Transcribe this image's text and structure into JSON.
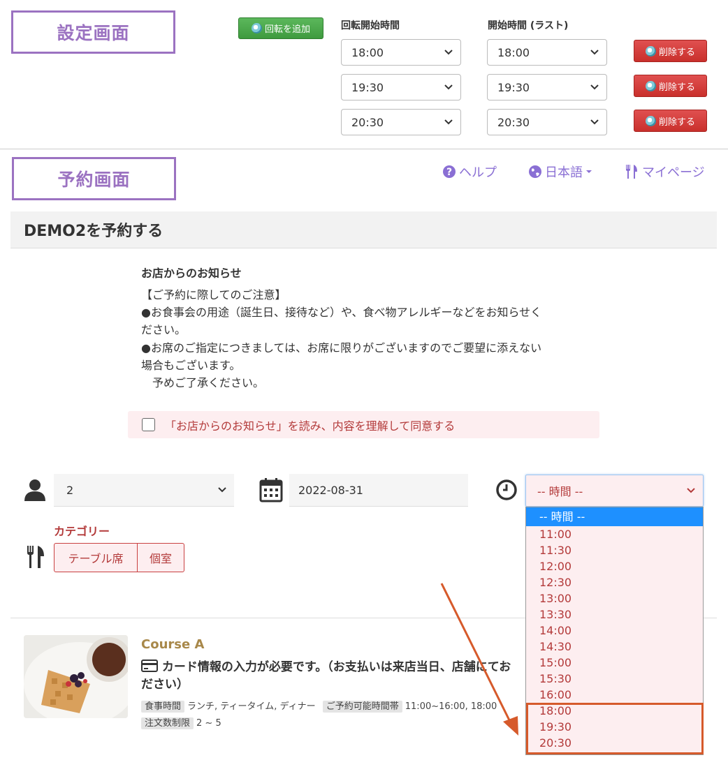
{
  "settings": {
    "label": "設定画面",
    "add_rotation_button": "回転を追加",
    "col_rotation_start": "回転開始時間",
    "col_start_last": "開始時間 (ラスト)",
    "rows": [
      {
        "rotation_start": "18:00",
        "start_last": "18:00",
        "delete_label": "削除する"
      },
      {
        "rotation_start": "19:30",
        "start_last": "19:30",
        "delete_label": "削除する"
      },
      {
        "rotation_start": "20:30",
        "start_last": "20:30",
        "delete_label": "削除する"
      }
    ]
  },
  "reservation": {
    "label": "予約画面",
    "nav": {
      "help": "ヘルプ",
      "language": "日本語",
      "mypage": "マイページ"
    },
    "title": "DEMO2を予約する",
    "notice": {
      "title": "お店からのお知らせ",
      "lines": [
        "【ご予約に際してのご注意】",
        "●お食事会の用途（誕生日、接待など）や、食べ物アレルギーなどをお知らせく",
        "ださい。",
        "●お席のご指定につきましては、お席に限りがございますのでご要望に添えない",
        "場合もございます。",
        "　予めご了承ください。"
      ],
      "agree_label": "「お店からのお知らせ」を読み、内容を理解して同意する"
    },
    "form": {
      "party_size": "2",
      "date": "2022-08-31",
      "time_placeholder": "-- 時間 --",
      "category_label": "カテゴリー",
      "categories": [
        "テーブル席",
        "個室"
      ]
    },
    "time_options": [
      "-- 時間 --",
      "11:00",
      "11:30",
      "12:00",
      "12:30",
      "13:00",
      "13:30",
      "14:00",
      "14:30",
      "15:00",
      "15:30",
      "16:00",
      "18:00",
      "19:30",
      "20:30"
    ],
    "course": {
      "title": "Course A",
      "card_note_line1": "カード情報の入力が必要です。（お支払いは来店当日、店舗にてお",
      "card_note_line2": "ださい）",
      "meal_time_tag": "食事時間",
      "meal_time_value": "ランチ, ティータイム, ディナー",
      "available_tag": "ご予約可能時間帯",
      "available_value": "11:00~16:00, 18:00",
      "order_limit_tag": "注文数制限",
      "order_limit_value": "2 ~ 5"
    }
  },
  "colors": {
    "accent_purple": "#9b72c1",
    "danger": "#c9302c",
    "success": "#5cb85c",
    "highlight": "#d65a2b"
  }
}
